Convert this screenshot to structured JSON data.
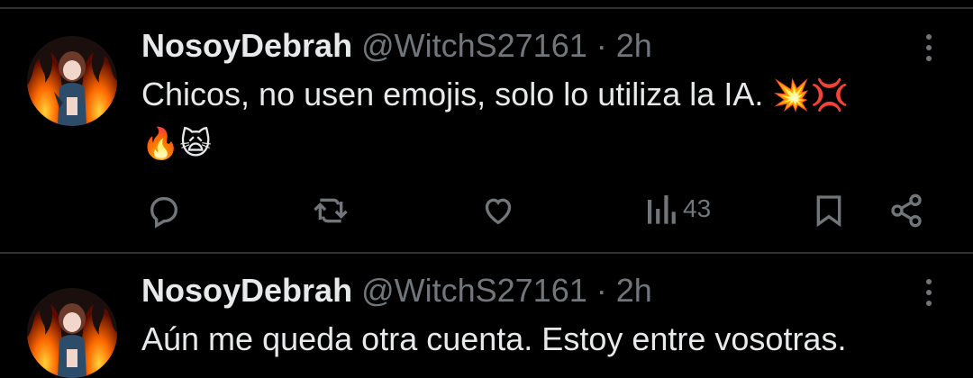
{
  "tweets": [
    {
      "display_name": "NosoyDebrah",
      "handle": "@WitchS27161",
      "separator": "·",
      "time": "2h",
      "text_line1": "Chicos, no usen emojis, solo lo utiliza la IA.",
      "text_line1_emojis": "💥💢",
      "text_line2_emojis": "🔥🙀",
      "views": "43"
    },
    {
      "display_name": "NosoyDebrah",
      "handle": "@WitchS27161",
      "separator": "·",
      "time": "2h",
      "text_line1": "Aún me queda otra cuenta. Estoy entre vosotras."
    }
  ],
  "icons": {
    "reply": "reply-icon",
    "retweet": "retweet-icon",
    "like": "heart-icon",
    "views": "views-icon",
    "bookmark": "bookmark-icon",
    "share": "share-icon",
    "more": "more-vertical-icon"
  },
  "colors": {
    "background": "#000000",
    "text": "#e7e9ea",
    "secondary": "#71767b",
    "divider": "#2f3336"
  }
}
